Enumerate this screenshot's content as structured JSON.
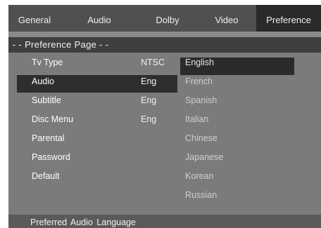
{
  "tabs": [
    {
      "label": "General"
    },
    {
      "label": "Audio"
    },
    {
      "label": "Dolby"
    },
    {
      "label": "Video"
    },
    {
      "label": "Preference",
      "active": true
    }
  ],
  "page_title": "- -  Preference Page  - -",
  "settings": [
    {
      "label": "Tv Type",
      "value": "NTSC"
    },
    {
      "label": "Audio",
      "value": "Eng",
      "selected": true
    },
    {
      "label": "Subtitle",
      "value": "Eng"
    },
    {
      "label": "Disc Menu",
      "value": "Eng"
    },
    {
      "label": "Parental",
      "value": ""
    },
    {
      "label": "Password",
      "value": ""
    },
    {
      "label": "Default",
      "value": ""
    }
  ],
  "options": [
    {
      "label": "English",
      "highlighted": true
    },
    {
      "label": "French"
    },
    {
      "label": "Spanish"
    },
    {
      "label": "Italian"
    },
    {
      "label": "Chinese"
    },
    {
      "label": "Japanese"
    },
    {
      "label": "Korean"
    },
    {
      "label": "Russian"
    }
  ],
  "status": "Preferred Audio Language",
  "colors": {
    "background": "#7b7b7b",
    "tabbar": "#505050",
    "active_tab": "#2a2a2a",
    "highlight": "#2e2e2e",
    "text": "#ffffff"
  }
}
